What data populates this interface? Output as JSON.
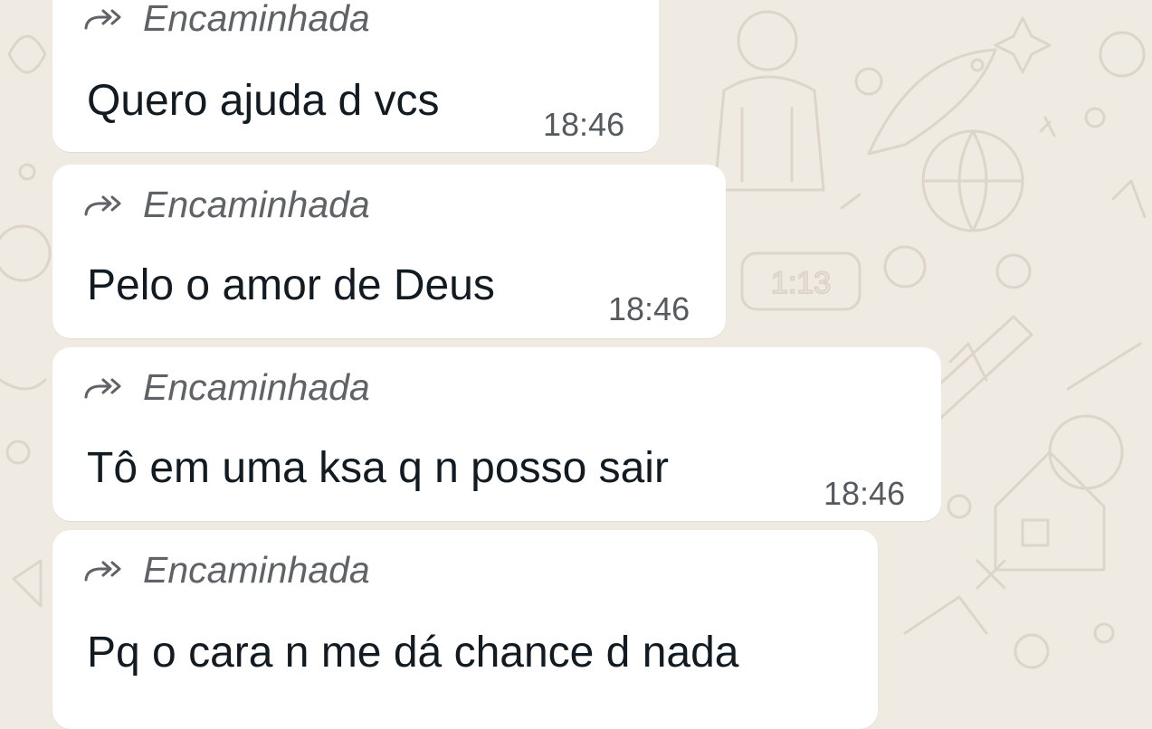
{
  "chat": {
    "forwarded_label": "Encaminhada",
    "messages": [
      {
        "text": "Quero ajuda d vcs",
        "time": "18:46",
        "forwarded": true
      },
      {
        "text": "Pelo o amor de Deus",
        "time": "18:46",
        "forwarded": true
      },
      {
        "text": "Tô em uma ksa q n posso sair",
        "time": "18:46",
        "forwarded": true
      },
      {
        "text": "Pq o cara n me dá chance d nada",
        "time": "",
        "forwarded": true
      }
    ]
  },
  "wallpaper": {
    "clock_text": "1:13"
  },
  "colors": {
    "background": "#efeae2",
    "bubble": "#ffffff",
    "text": "#111b21",
    "meta": "#5f6266"
  },
  "icons": {
    "forward": "forwarded-arrow-icon"
  }
}
